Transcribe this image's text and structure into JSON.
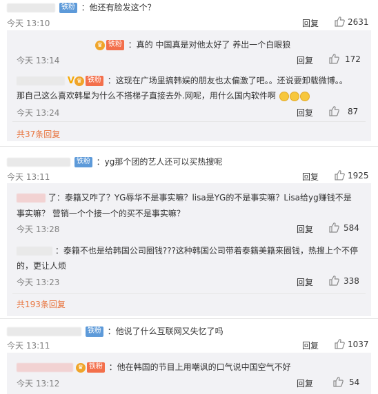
{
  "badges": {
    "fans": "铁粉"
  },
  "reply_label": "回复",
  "comments": [
    {
      "text": "：他还有脸发这个？",
      "time": "今天 13:10",
      "likes": "2631"
    },
    {
      "text": "：真的 中国真是对他太好了 养出一个白眼狼",
      "time": "今天 13:14",
      "likes": "172"
    },
    {
      "text_line1": "：这现在广场里搞韩娱的朋友也太偏激了吧。。还说要卸载微博。。",
      "text_line2": "那自己这么喜欢韩星为什么不搭梯子直接去外.网呢，用什么国内软件啊",
      "time": "今天 13:24",
      "likes": "87"
    },
    {
      "more": "共37条回复"
    },
    {
      "text": "：yg那个团的艺人还可以买热搜呢",
      "time": "今天 13:11",
      "likes": "1925"
    },
    {
      "text_line1": "了：泰籍又咋了？YG辱华不是事实嘛？lisa是YG的不是事实嘛？Lisa给yg赚钱不是",
      "text_line2": "事实嘛？ 营销一个个接一个的买不是事实嘛？",
      "time": "今天 13:28",
      "likes": "584"
    },
    {
      "text_line1": "：泰籍不也是给韩国公司圈钱???这种韩国公司带着泰籍美籍来圈钱，热搜上个不停",
      "text_line2": "的，更让人烦",
      "time": "今天 13:23",
      "likes": "338"
    },
    {
      "more": "共193条回复"
    },
    {
      "text": "：他说了什么互联网又失忆了吗",
      "time": "今天 13:11",
      "likes": "1037"
    },
    {
      "text": "：他在韩国的节目上用嘲讽的口气说中国空气不好",
      "time": "今天 13:12",
      "likes": "54"
    }
  ],
  "icons": {
    "like": "thumbs-up-icon",
    "crown": "crown-icon",
    "verified": "verified-v-icon",
    "emoji": "laugh-cry-emoji-icon"
  },
  "colors": {
    "link": "#e8733c",
    "badge": "#5d9ad9",
    "subpanel": "#f2f2f5"
  }
}
